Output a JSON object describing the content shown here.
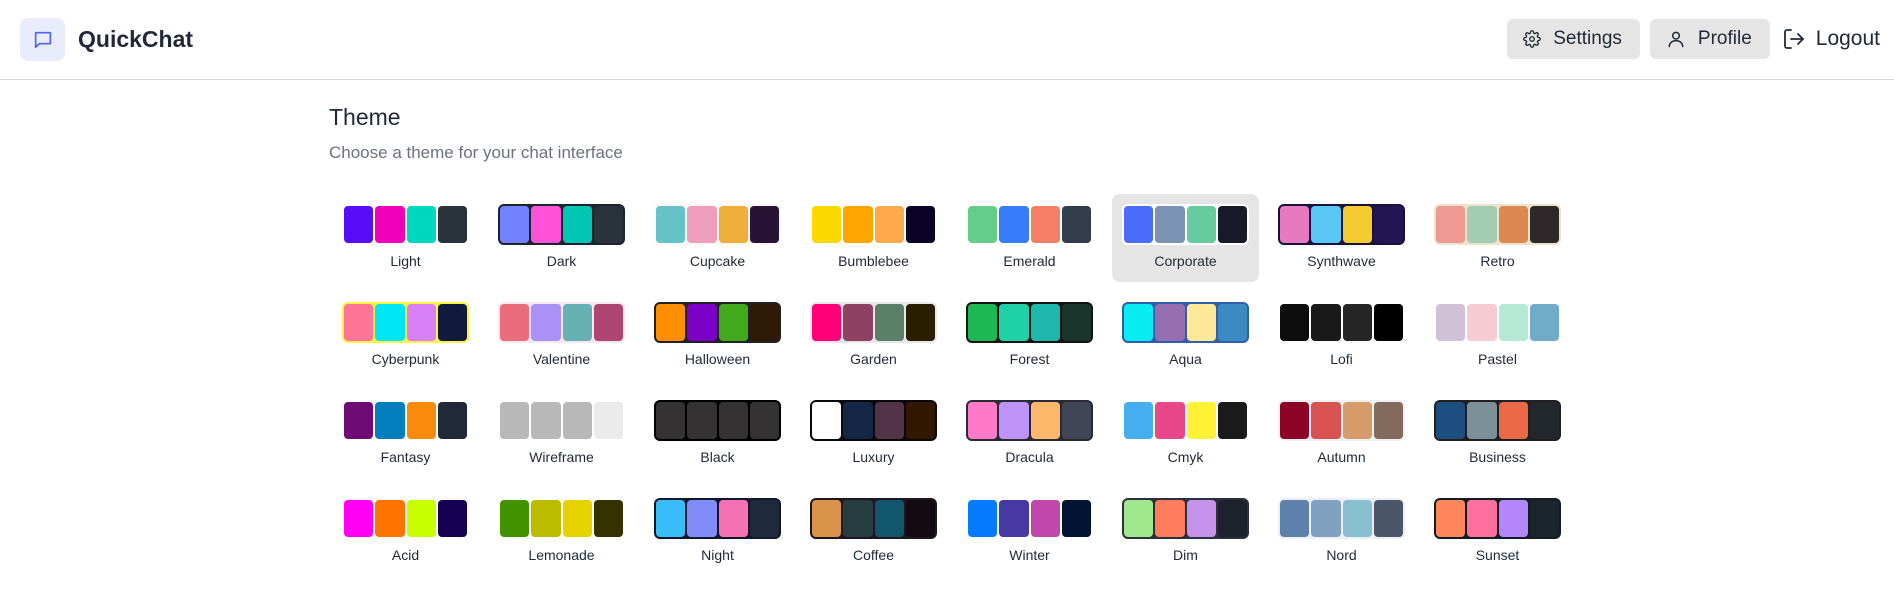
{
  "app": {
    "name": "QuickChat",
    "logo_icon": "chat-bubble-icon",
    "accent": "#4f63f0"
  },
  "nav": {
    "settings_label": "Settings",
    "profile_label": "Profile",
    "logout_label": "Logout"
  },
  "page": {
    "title": "Theme",
    "subtitle": "Choose a theme for your chat interface",
    "selected_theme": "Corporate"
  },
  "themes": [
    {
      "name": "Light",
      "frame": "#ffffff",
      "colors": [
        "#570df8",
        "#f000b8",
        "#00d7c0",
        "#2a323c"
      ]
    },
    {
      "name": "Dark",
      "frame": "#1d232a",
      "colors": [
        "#7582ff",
        "#ff52d9",
        "#00c7b5",
        "#2a323c"
      ]
    },
    {
      "name": "Cupcake",
      "frame": "#faf7f5",
      "colors": [
        "#65c3c8",
        "#ef9fbc",
        "#eeaf3a",
        "#291334"
      ]
    },
    {
      "name": "Bumblebee",
      "frame": "#ffffff",
      "colors": [
        "#fad900",
        "#ffa600",
        "#ffa94d",
        "#0b0226"
      ]
    },
    {
      "name": "Emerald",
      "frame": "#ffffff",
      "colors": [
        "#66cc8a",
        "#377cfb",
        "#f68067",
        "#333c4d"
      ]
    },
    {
      "name": "Corporate",
      "frame": "#ffffff",
      "colors": [
        "#4b6bfb",
        "#7b92b2",
        "#67cba0",
        "#181a2a"
      ]
    },
    {
      "name": "Synthwave",
      "frame": "#1a103d",
      "colors": [
        "#e779c1",
        "#58c7f3",
        "#f3cc30",
        "#221551"
      ]
    },
    {
      "name": "Retro",
      "frame": "#ece3ca",
      "colors": [
        "#ef9995",
        "#a4cbb4",
        "#dc8850",
        "#2e282a"
      ]
    },
    {
      "name": "Cyberpunk",
      "frame": "#fff248",
      "colors": [
        "#ff7598",
        "#00e6f6",
        "#d681f8",
        "#111a3b"
      ]
    },
    {
      "name": "Valentine",
      "frame": "#fae7f4",
      "colors": [
        "#e96d7b",
        "#a991f7",
        "#66b1b3",
        "#af4670"
      ]
    },
    {
      "name": "Halloween",
      "frame": "#212121",
      "colors": [
        "#ff8f00",
        "#7b00c6",
        "#42a91c",
        "#2f1b05"
      ]
    },
    {
      "name": "Garden",
      "frame": "#e9e7e7",
      "colors": [
        "#ff0079",
        "#8e4162",
        "#5c7f67",
        "#291e00"
      ]
    },
    {
      "name": "Forest",
      "frame": "#171212",
      "colors": [
        "#1eb854",
        "#1fd1a6",
        "#1db8ab",
        "#19362d"
      ]
    },
    {
      "name": "Aqua",
      "frame": "#345da7",
      "colors": [
        "#09ecf3",
        "#966fb3",
        "#ffe999",
        "#3b8ac4"
      ]
    },
    {
      "name": "Lofi",
      "frame": "#ffffff",
      "colors": [
        "#0d0d0d",
        "#1a1919",
        "#262626",
        "#000000"
      ]
    },
    {
      "name": "Pastel",
      "frame": "#ffffff",
      "colors": [
        "#d1c1d7",
        "#f6cbd1",
        "#b4e9d6",
        "#70acc7"
      ]
    },
    {
      "name": "Fantasy",
      "frame": "#ffffff",
      "colors": [
        "#6e0b75",
        "#007ebd",
        "#f88b0b",
        "#1f2937"
      ]
    },
    {
      "name": "Wireframe",
      "frame": "#ffffff",
      "colors": [
        "#b8b8b8",
        "#b8b8b8",
        "#b8b8b8",
        "#ebebeb"
      ]
    },
    {
      "name": "Black",
      "frame": "#000000",
      "colors": [
        "#343232",
        "#343232",
        "#343232",
        "#343232"
      ]
    },
    {
      "name": "Luxury",
      "frame": "#09090b",
      "colors": [
        "#ffffff",
        "#152747",
        "#513448",
        "#331800"
      ]
    },
    {
      "name": "Dracula",
      "frame": "#282a36",
      "colors": [
        "#ff79c6",
        "#bd93f9",
        "#ffb86c",
        "#414558"
      ]
    },
    {
      "name": "Cmyk",
      "frame": "#ffffff",
      "colors": [
        "#45aeee",
        "#e8488a",
        "#fff235",
        "#1a1a1a"
      ]
    },
    {
      "name": "Autumn",
      "frame": "#f1f1f1",
      "colors": [
        "#8c0327",
        "#d85251",
        "#d59b6a",
        "#826a5c"
      ]
    },
    {
      "name": "Business",
      "frame": "#202020",
      "colors": [
        "#1c4e80",
        "#7c909a",
        "#ea6947",
        "#23282e"
      ]
    },
    {
      "name": "Acid",
      "frame": "#fafafa",
      "colors": [
        "#ff00f4",
        "#ff7400",
        "#c8ff00",
        "#140152"
      ]
    },
    {
      "name": "Lemonade",
      "frame": "#ffffff",
      "colors": [
        "#419400",
        "#bbbb00",
        "#e5d200",
        "#343300"
      ]
    },
    {
      "name": "Night",
      "frame": "#0f172a",
      "colors": [
        "#38bdf8",
        "#818cf8",
        "#f471b5",
        "#1e293b"
      ]
    },
    {
      "name": "Coffee",
      "frame": "#20161f",
      "colors": [
        "#db924b",
        "#263e3f",
        "#10576d",
        "#120c12"
      ]
    },
    {
      "name": "Winter",
      "frame": "#ffffff",
      "colors": [
        "#047aff",
        "#463aa2",
        "#c148ac",
        "#021431"
      ]
    },
    {
      "name": "Dim",
      "frame": "#2a303c",
      "colors": [
        "#9fe88d",
        "#ff7d5c",
        "#c792e9",
        "#1c212b"
      ]
    },
    {
      "name": "Nord",
      "frame": "#eceff4",
      "colors": [
        "#5e81ac",
        "#81a1c1",
        "#88c0d0",
        "#4c566a"
      ]
    },
    {
      "name": "Sunset",
      "frame": "#121c22",
      "colors": [
        "#ff865b",
        "#fd6f9c",
        "#b387fa",
        "#1b262c"
      ]
    }
  ]
}
